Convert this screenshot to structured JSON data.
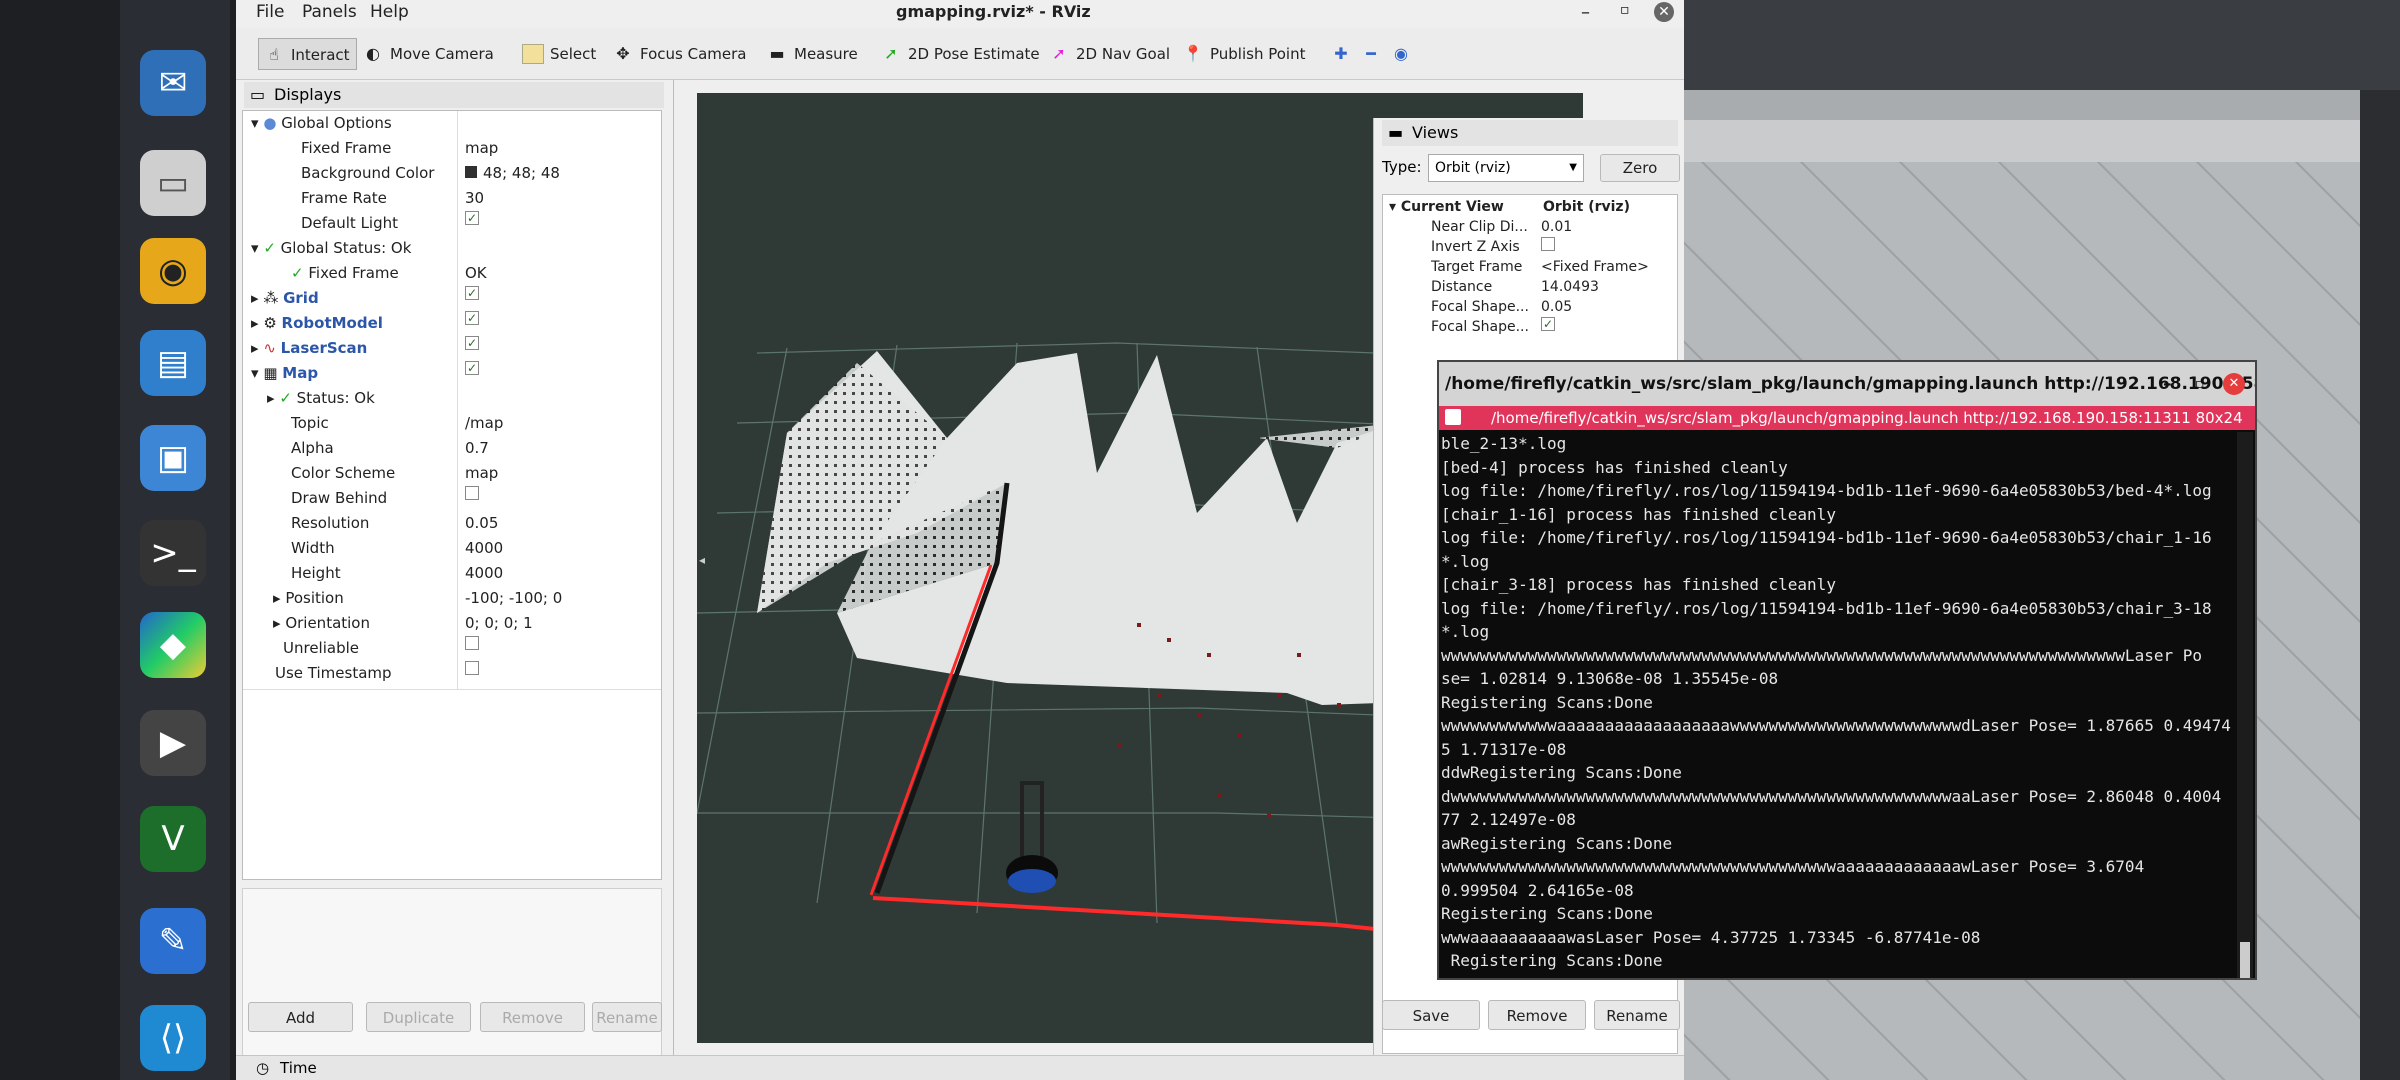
{
  "window_title": "gmapping.rviz* - RViz",
  "menu": [
    "File",
    "Panels",
    "Help"
  ],
  "toolbar": {
    "interact": "Interact",
    "move_camera": "Move Camera",
    "select": "Select",
    "focus_camera": "Focus Camera",
    "measure": "Measure",
    "pose_estimate": "2D Pose Estimate",
    "nav_goal": "2D Nav Goal",
    "publish_point": "Publish Point"
  },
  "displays": {
    "title": "Displays",
    "rows": [
      {
        "label": "Global Options",
        "value": ""
      },
      {
        "label": "Fixed Frame",
        "value": "map"
      },
      {
        "label": "Background Color",
        "value": "48; 48; 48"
      },
      {
        "label": "Frame Rate",
        "value": "30"
      },
      {
        "label": "Default Light",
        "value": "✓"
      },
      {
        "label": "Global Status: Ok",
        "value": ""
      },
      {
        "label": "Fixed Frame",
        "value": "OK"
      },
      {
        "label": "Grid",
        "value": "✓"
      },
      {
        "label": "RobotModel",
        "value": "✓"
      },
      {
        "label": "LaserScan",
        "value": "✓"
      },
      {
        "label": "Map",
        "value": "✓"
      },
      {
        "label": "Status: Ok",
        "value": ""
      },
      {
        "label": "Topic",
        "value": "/map"
      },
      {
        "label": "Alpha",
        "value": "0.7"
      },
      {
        "label": "Color Scheme",
        "value": "map"
      },
      {
        "label": "Draw Behind",
        "value": ""
      },
      {
        "label": "Resolution",
        "value": "0.05"
      },
      {
        "label": "Width",
        "value": "4000"
      },
      {
        "label": "Height",
        "value": "4000"
      },
      {
        "label": "Position",
        "value": "-100; -100; 0"
      },
      {
        "label": "Orientation",
        "value": "0; 0; 0; 1"
      },
      {
        "label": "Unreliable",
        "value": ""
      },
      {
        "label": "Use Timestamp",
        "value": ""
      }
    ],
    "buttons": {
      "add": "Add",
      "duplicate": "Duplicate",
      "remove": "Remove",
      "rename": "Rename"
    }
  },
  "views": {
    "title": "Views",
    "type_label": "Type:",
    "type_value": "Orbit (rviz)",
    "zero": "Zero",
    "current_view": "Current View",
    "current_view_value": "Orbit (rviz)",
    "rows": [
      {
        "label": "Near Clip Di...",
        "value": "0.01"
      },
      {
        "label": "Invert Z Axis",
        "value": ""
      },
      {
        "label": "Target Frame",
        "value": "<Fixed Frame>"
      },
      {
        "label": "Distance",
        "value": "14.0493"
      },
      {
        "label": "Focal Shape...",
        "value": "0.05"
      },
      {
        "label": "Focal Shape...",
        "value": "✓"
      }
    ],
    "buttons": {
      "save": "Save",
      "remove": "Remove",
      "rename": "Rename"
    }
  },
  "time_panel": "Time",
  "terminal": {
    "title": "/home/firefly/catkin_ws/src/slam_pkg/launch/gmapping.launch http://192.168.190.158:...",
    "tab": "/home/firefly/catkin_ws/src/slam_pkg/launch/gmapping.launch http://192.168.190.158:11311 80x24",
    "lines": [
      "ble_2-13*.log",
      "[bed-4] process has finished cleanly",
      "log file: /home/firefly/.ros/log/11594194-bd1b-11ef-9690-6a4e05830b53/bed-4*.log",
      "[chair_1-16] process has finished cleanly",
      "log file: /home/firefly/.ros/log/11594194-bd1b-11ef-9690-6a4e05830b53/chair_1-16",
      "*.log",
      "[chair_3-18] process has finished cleanly",
      "log file: /home/firefly/.ros/log/11594194-bd1b-11ef-9690-6a4e05830b53/chair_3-18",
      "*.log",
      "wwwwwwwwwwwwwwwwwwwwwwwwwwwwwwwwwwwwwwwwwwwwwwwwwwwwwwwwwwwwwwwwwwwwwwwLaser Po",
      "se= 1.02814 9.13068e-08 1.35545e-08",
      "Registering Scans:Done",
      "wwwwwwwwwwwwaaaaaaaaaaaaaaaaaawwwwwwwwwwwwwwwwwwwwwwwwdLaser Pose= 1.87665 0.49474",
      "5 1.71317e-08",
      "ddwRegistering Scans:Done",
      "dwwwwwwwwwwwwwwwwwwwwwwwwwwwwwwwwwwwwwwwwwwwwwwwwwwwwaaLaser Pose= 2.86048 0.4004",
      "77 2.12497e-08",
      "awRegistering Scans:Done",
      "wwwwwwwwwwwwwwwwwwwwwwwwwwwwwwwwwwwwwwwwwaaaaaaaaaaaaawLaser Pose= 3.6704",
      "0.999504 2.64165e-08",
      "Registering Scans:Done",
      "wwwaaaaaaaaaawasLaser Pose= 4.37725 1.73345 -6.87741e-08",
      " Registering Scans:Done"
    ]
  },
  "colors": {
    "viewport_bg": "#2f3a36",
    "map_free": "#e4e6e5",
    "laser": "#ff2020",
    "terminal_tab": "#e0345a"
  }
}
